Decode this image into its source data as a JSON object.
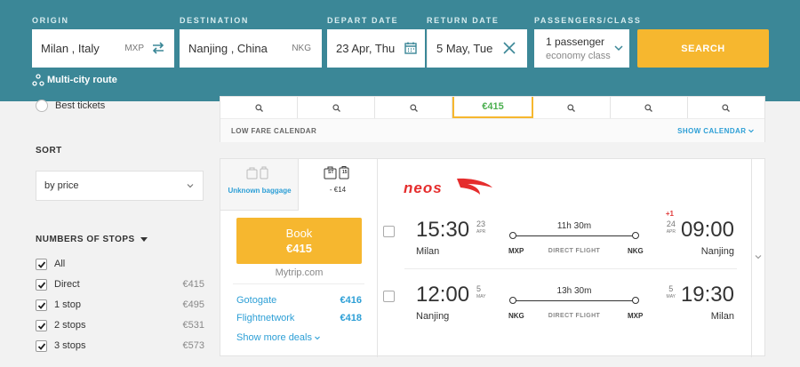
{
  "search": {
    "origin_label": "ORIGIN",
    "origin_value": "Milan , Italy",
    "origin_code": "MXP",
    "destination_label": "DESTINATION",
    "destination_value": "Nanjing , China",
    "destination_code": "NKG",
    "depart_label": "DEPART DATE",
    "depart_value": "23 Apr, Thu",
    "return_label": "RETURN DATE",
    "return_value": "5 May, Tue",
    "pax_label": "PASSENGERS/CLASS",
    "pax_value": "1 passenger",
    "class_value": "economy class",
    "search_button": "SEARCH",
    "multicity": "Multi-city route"
  },
  "filters": {
    "best_tickets": "Best tickets",
    "sort_title": "SORT",
    "sort_value": "by price",
    "stops_title": "NUMBERS OF STOPS",
    "stops": [
      {
        "label": "All",
        "price": ""
      },
      {
        "label": "Direct",
        "price": "€415"
      },
      {
        "label": "1 stop",
        "price": "€495"
      },
      {
        "label": "2 stops",
        "price": "€531"
      },
      {
        "label": "3 stops",
        "price": "€573"
      }
    ]
  },
  "calendar": {
    "active_price": "€415",
    "label": "LOW FARE CALENDAR",
    "link": "SHOW CALENDAR"
  },
  "result": {
    "baggage_unknown": "Unknown baggage",
    "baggage_alt_price": "- €14",
    "baggage_alt_tags": [
      "ST",
      "15"
    ],
    "book_label": "Book",
    "book_price": "€415",
    "seller": "Mytrip.com",
    "deals": [
      {
        "name": "Gotogate",
        "price": "€416"
      },
      {
        "name": "Flightnetwork",
        "price": "€418"
      }
    ],
    "more_deals": "Show more deals",
    "airline": "neos",
    "legs": [
      {
        "dep_time": "15:30",
        "dep_day": "23",
        "dep_month": "APR",
        "dep_city": "Milan",
        "arr_time": "09:00",
        "arr_day": "24",
        "arr_month": "APR",
        "arr_city": "Nanjing",
        "plus_day": "+1",
        "duration": "11h 30m",
        "from_code": "MXP",
        "to_code": "NKG",
        "type": "DIRECT FLIGHT"
      },
      {
        "dep_time": "12:00",
        "dep_day": "5",
        "dep_month": "MAY",
        "dep_city": "Nanjing",
        "arr_time": "19:30",
        "arr_day": "5",
        "arr_month": "MAY",
        "arr_city": "Milan",
        "plus_day": "",
        "duration": "13h 30m",
        "from_code": "NKG",
        "to_code": "MXP",
        "type": "DIRECT FLIGHT"
      }
    ]
  },
  "colors": {
    "header": "#3b8797",
    "accent": "#f6b72f",
    "link": "#2d9fd6",
    "cheap": "#4caf50",
    "airline": "#e52d2d"
  }
}
